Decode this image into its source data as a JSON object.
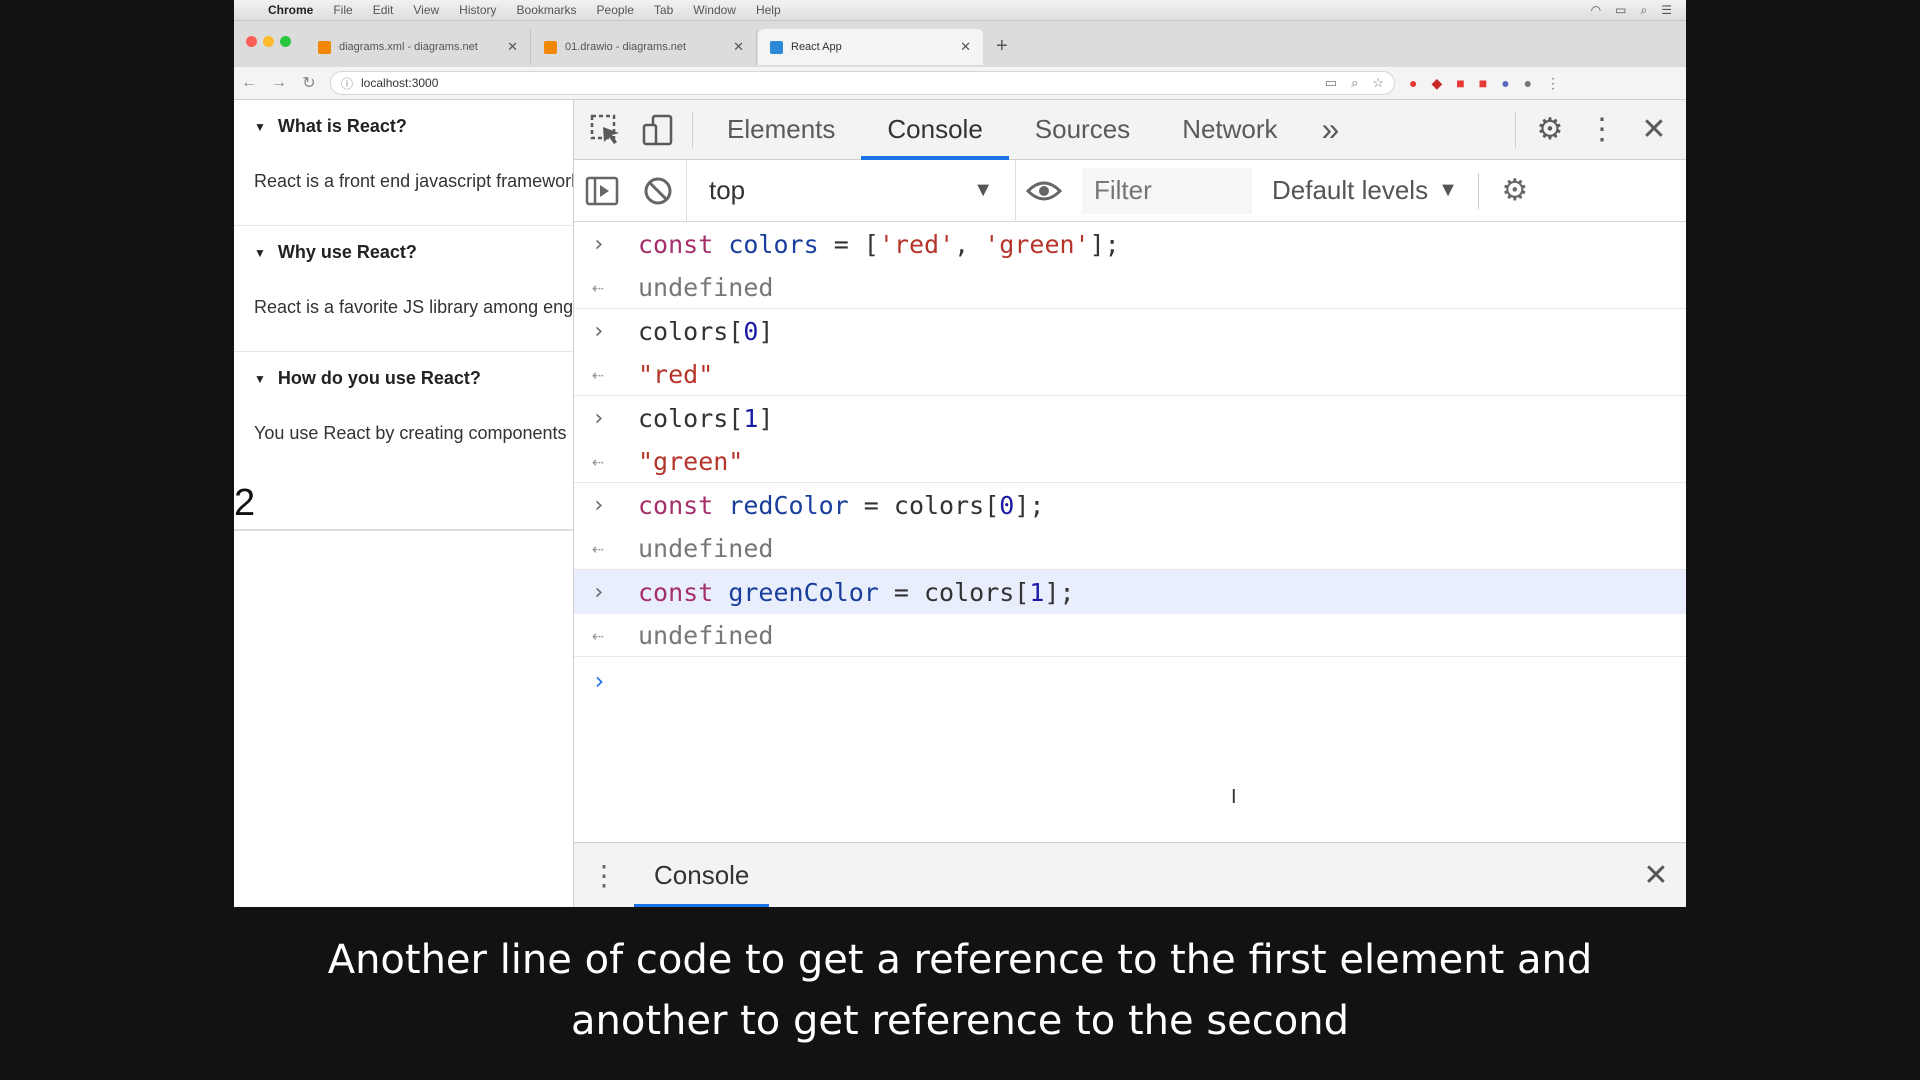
{
  "menubar": {
    "app": "Chrome",
    "items": [
      "File",
      "Edit",
      "View",
      "History",
      "Bookmarks",
      "People",
      "Tab",
      "Window",
      "Help"
    ]
  },
  "tabs": [
    {
      "label": "diagrams.xml - diagrams.net",
      "favicon_color": "#f08705"
    },
    {
      "label": "01.drawio - diagrams.net",
      "favicon_color": "#f08705"
    },
    {
      "label": "React App",
      "favicon_color": "#2b89d6"
    }
  ],
  "address": {
    "url": "localhost:3000"
  },
  "page": {
    "sections": [
      {
        "question": "What is React?",
        "answer": "React is a front end javascript framework"
      },
      {
        "question": "Why use React?",
        "answer": "React is a favorite JS library among engineers"
      },
      {
        "question": "How do you use React?",
        "answer": "You use React by creating components"
      }
    ],
    "counter": "2"
  },
  "devtools": {
    "tabs": [
      "Elements",
      "Console",
      "Sources",
      "Network"
    ],
    "active_tab": "Console",
    "more_label": "»",
    "context": "top",
    "filter_placeholder": "Filter",
    "levels": "Default levels",
    "drawer_tab": "Console"
  },
  "console": {
    "entries": [
      {
        "input": {
          "kw": "const",
          "name": "colors",
          "rest": " = [",
          "s1": "'red'",
          "mid": ", ",
          "s2": "'green'",
          "end": "];"
        },
        "output": "undefined"
      },
      {
        "input_plain": {
          "pre": "colors[",
          "idx": "0",
          "post": "]"
        },
        "output_str": "\"red\""
      },
      {
        "input_plain": {
          "pre": "colors[",
          "idx": "1",
          "post": "]"
        },
        "output_str": "\"green\""
      },
      {
        "input2": {
          "kw": "const",
          "name": "redColor",
          "rest": " = colors[",
          "idx": "0",
          "end": "];"
        },
        "output": "undefined"
      },
      {
        "input2": {
          "kw": "const",
          "name": "greenColor",
          "rest": " = colors[",
          "idx": "1",
          "end": "];"
        },
        "output": "undefined"
      }
    ]
  },
  "caption": {
    "line1": "Another line of code to get a reference to the first element and",
    "line2": "another to get reference to the second"
  }
}
